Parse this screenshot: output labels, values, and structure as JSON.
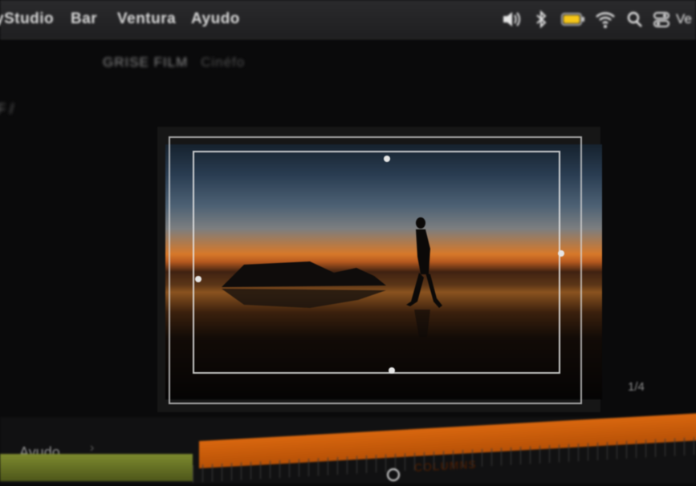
{
  "menubar": {
    "items": [
      "yStudio",
      "Bar",
      "Ventura",
      "Ayudo"
    ],
    "clock": "Ve",
    "icons": [
      "volume-icon",
      "bluetooth-icon",
      "battery-icon",
      "wifi-icon",
      "search-icon",
      "control-center-icon"
    ],
    "battery_color": "#f5c518"
  },
  "panel": {
    "title": "GRISE FILM",
    "subtitle": "Cinéfo",
    "zoom_label": "F /"
  },
  "viewer": {
    "page_indicator": "1/4"
  },
  "timeline": {
    "label": "Ayudo",
    "clip_label": "COLUMNS",
    "accent_orange": "#d9670f",
    "accent_green": "#7d8a2e"
  }
}
